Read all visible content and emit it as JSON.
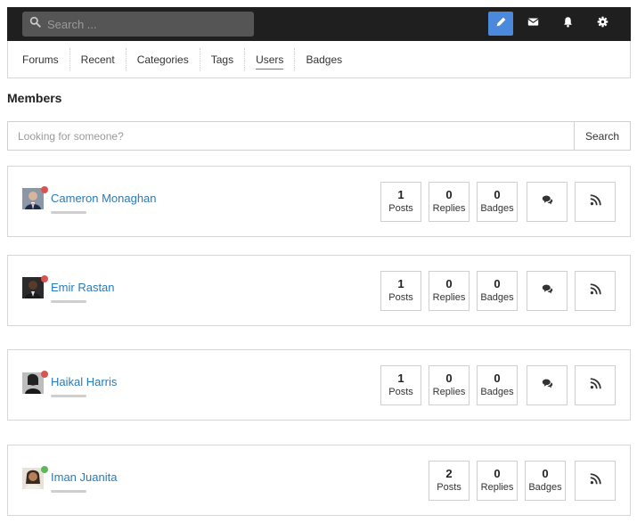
{
  "topbar": {
    "search_placeholder": "Search ...",
    "icons": [
      "search-icon",
      "pencil-icon",
      "envelope-icon",
      "bell-icon",
      "gear-icon"
    ],
    "accent_color": "#4a89dc"
  },
  "nav": {
    "items": [
      "Forums",
      "Recent",
      "Categories",
      "Tags",
      "Users",
      "Badges"
    ],
    "active": "Users"
  },
  "page": {
    "title": "Members"
  },
  "member_search": {
    "placeholder": "Looking for someone?",
    "button_label": "Search"
  },
  "members": [
    {
      "name": "Cameron Monaghan",
      "status": "offline",
      "status_color": "#d9534f",
      "posts": "1",
      "posts_label": "Posts",
      "replies": "0",
      "replies_label": "Replies",
      "badges": "0",
      "badges_label": "Badges",
      "actions": [
        "chat-icon",
        "rss-icon"
      ]
    },
    {
      "name": "Emir Rastan",
      "status": "offline",
      "status_color": "#d9534f",
      "posts": "1",
      "posts_label": "Posts",
      "replies": "0",
      "replies_label": "Replies",
      "badges": "0",
      "badges_label": "Badges",
      "actions": [
        "chat-icon",
        "rss-icon"
      ]
    },
    {
      "name": "Haikal Harris",
      "status": "offline",
      "status_color": "#d9534f",
      "posts": "1",
      "posts_label": "Posts",
      "replies": "0",
      "replies_label": "Replies",
      "badges": "0",
      "badges_label": "Badges",
      "actions": [
        "chat-icon",
        "rss-icon"
      ]
    },
    {
      "name": "Iman Juanita",
      "status": "online",
      "status_color": "#5cb85c",
      "posts": "2",
      "posts_label": "Posts",
      "replies": "0",
      "replies_label": "Replies",
      "badges": "0",
      "badges_label": "Badges",
      "actions": [
        "rss-icon"
      ]
    }
  ]
}
